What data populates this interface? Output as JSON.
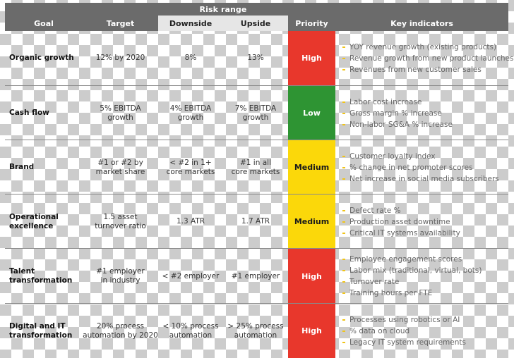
{
  "header": {
    "group_label": "Risk range",
    "columns": {
      "goal": "Goal",
      "target": "Target",
      "downside": "Downside",
      "upside": "Upside",
      "priority": "Priority",
      "key_indicators": "Key indicators"
    },
    "colors": {
      "bar": "#6b6b6b",
      "subbar": "#e6e6e6",
      "high": "#e8372c",
      "low": "#2e9433",
      "medium": "#fbd80a",
      "bullet": "#f0c419"
    }
  },
  "rows": [
    {
      "goal": "Organic growth",
      "target": "12% by 2020",
      "downside": "8%",
      "upside": "13%",
      "priority": "High",
      "priority_level": "high",
      "key_indicators": [
        "YOY revenue growth (existing products)",
        "Revenue growth from new product launches",
        "Revenues from new customer sales"
      ]
    },
    {
      "goal": "Cash flow",
      "target": "5% EBITDA\ngrowth",
      "downside": "4% EBITDA\ngrowth",
      "upside": "7% EBITDA\ngrowth",
      "priority": "Low",
      "priority_level": "low",
      "key_indicators": [
        "Labor cost increase",
        "Gross margin % increase",
        "Non-labor SG&A % increase"
      ]
    },
    {
      "goal": "Brand",
      "target": "#1 or #2 by\nmarket share",
      "downside": "< #2 in 1+\ncore markets",
      "upside": "#1 in all\ncore markets",
      "priority": "Medium",
      "priority_level": "medium",
      "key_indicators": [
        "Customer loyalty index",
        "% change in net promoter scores",
        "Net increase in social media subscribers"
      ]
    },
    {
      "goal": "Operational\nexcellence",
      "target": "1.5 asset\nturnover ratio",
      "downside": "1.3 ATR",
      "upside": "1.7 ATR",
      "priority": "Medium",
      "priority_level": "medium",
      "key_indicators": [
        "Defect rate %",
        "Production asset downtime",
        "Critical IT systems availability"
      ]
    },
    {
      "goal": "Talent\ntransformation",
      "target": "#1 employer\nin industry",
      "downside": "< #2 employer",
      "upside": "#1 employer",
      "priority": "High",
      "priority_level": "high",
      "key_indicators": [
        "Employee engagement scores",
        "Labor mix (traditional, virtual, bots)",
        "Turnover rate",
        "Training hours per FTE"
      ]
    },
    {
      "goal": "Digital and IT\ntransformation",
      "target": "20% process\nautomation by 2020",
      "downside": "< 10% process\nautomation",
      "upside": "> 25% process\nautomation",
      "priority": "High",
      "priority_level": "high",
      "key_indicators": [
        "Processes using robotics or AI",
        "% data on cloud",
        "Legacy IT system requirements"
      ]
    }
  ]
}
